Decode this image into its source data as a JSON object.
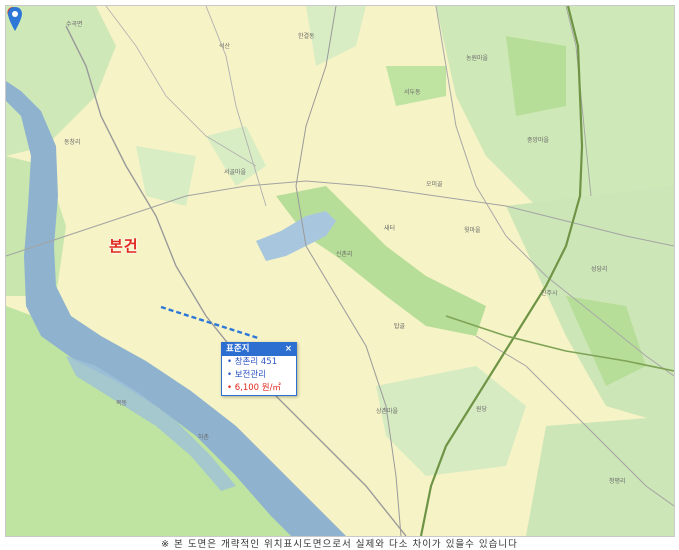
{
  "map": {
    "subject_label": "본건",
    "place_labels": [
      "수곡면",
      "한결동",
      "석산",
      "농원마을",
      "서두동",
      "동창리",
      "서골마을",
      "오미골",
      "중앙마을",
      "새터",
      "신촌리",
      "윗마을",
      "탑골",
      "목동",
      "하촌",
      "상촌마을",
      "진주시",
      "성당리",
      "원당",
      "청평리"
    ]
  },
  "popup": {
    "title": "표준지",
    "close_label": "×",
    "address": "• 창촌리 451",
    "zoning": "• 보전관리",
    "price": "• 6,100 원/㎡"
  },
  "footer": {
    "disclaimer": "※ 본 도면은 개략적인 위치표시도면으로서 실제와 다소 차이가 있을수 있습니다"
  },
  "colors": {
    "base": "#f6f3c6",
    "forest": "#cfe8b8",
    "farmland": "#b7de98",
    "river": "#8fb3cf",
    "road_gray": "#9a9a9a",
    "railway": "#6f9445",
    "subject_pin": "#e0281c",
    "standard_pin": "#2d6fd0"
  }
}
